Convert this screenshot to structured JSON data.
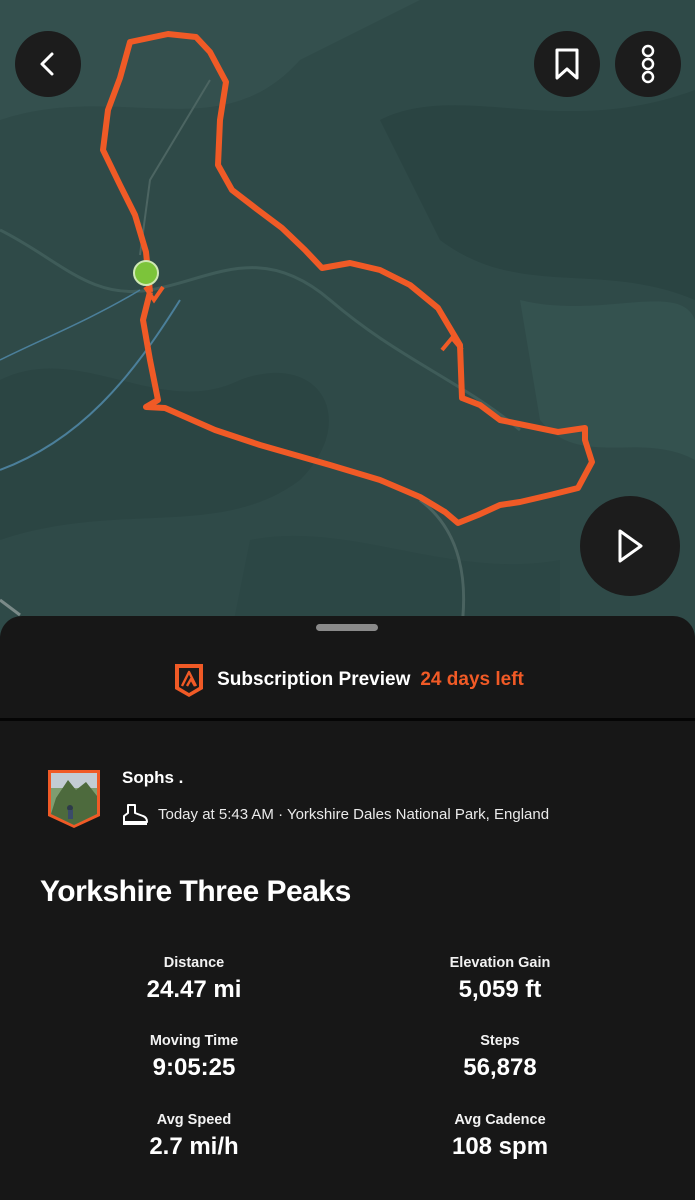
{
  "header": {
    "back_icon": "chevron-left-icon",
    "bookmark_icon": "bookmark-icon",
    "more_icon": "more-vertical-icon"
  },
  "map": {
    "route_color": "#f05a26",
    "start_marker_color": "#7cc43a",
    "terrain_color": "#2f4a48",
    "play_icon": "play-icon"
  },
  "promo": {
    "label": "Subscription Preview",
    "days_left": "24 days left",
    "accent_color": "#f05a26"
  },
  "activity": {
    "athlete_name": "Sophs .",
    "activity_icon": "hiking-boot-icon",
    "meta": "Today at 5:43 AM · Yorkshire Dales National Park, England",
    "title": "Yorkshire Three Peaks"
  },
  "stats": [
    {
      "label": "Distance",
      "value": "24.47 mi"
    },
    {
      "label": "Elevation Gain",
      "value": "5,059 ft"
    },
    {
      "label": "Moving Time",
      "value": "9:05:25"
    },
    {
      "label": "Steps",
      "value": "56,878"
    },
    {
      "label": "Avg Speed",
      "value": "2.7 mi/h"
    },
    {
      "label": "Avg Cadence",
      "value": "108 spm"
    }
  ]
}
